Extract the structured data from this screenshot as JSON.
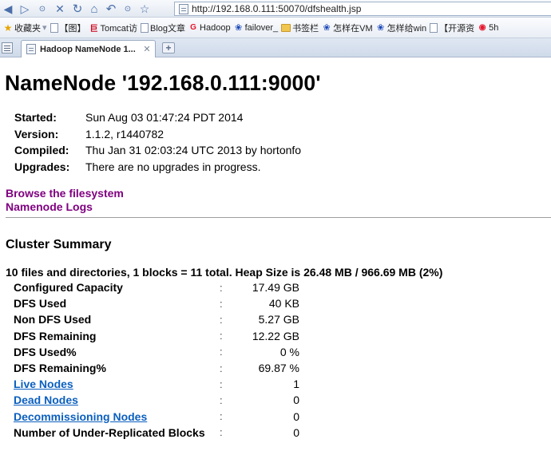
{
  "browser": {
    "url": "http://192.168.0.111:50070/dfshealth.jsp",
    "nav_icons": [
      "back-icon",
      "forward-icon",
      "dropdown-icon",
      "stop-icon",
      "refresh-icon",
      "home-icon",
      "history-icon",
      "dropdown-icon",
      "favorite-star-icon"
    ],
    "bookmarks": [
      {
        "label": "收藏夹",
        "icon": "star-icon"
      },
      {
        "label": "【图】",
        "icon": "page-icon"
      },
      {
        "label": "Tomcat访",
        "icon": "ju-icon"
      },
      {
        "label": "Blog文章",
        "icon": "page-icon"
      },
      {
        "label": "Hadoop",
        "icon": "weibo-icon"
      },
      {
        "label": "failover_",
        "icon": "paw-icon"
      },
      {
        "label": "书签栏",
        "icon": "folder-icon"
      },
      {
        "label": "怎样在VM",
        "icon": "paw-icon"
      },
      {
        "label": "怎样给win",
        "icon": "paw-icon"
      },
      {
        "label": "【开源资",
        "icon": "page-icon"
      },
      {
        "label": "5h",
        "icon": "weibo-icon"
      }
    ],
    "tab_title": "Hadoop NameNode 1..."
  },
  "page": {
    "title": "NameNode '192.168.0.111:9000'",
    "info": [
      {
        "label": "Started:",
        "value": "Sun Aug 03 01:47:24 PDT 2014"
      },
      {
        "label": "Version:",
        "value": "1.1.2, r1440782"
      },
      {
        "label": "Compiled:",
        "value": "Thu Jan 31 02:03:24 UTC 2013 by hortonfo"
      },
      {
        "label": "Upgrades:",
        "value": "There are no upgrades in progress."
      }
    ],
    "links": [
      {
        "label": "Browse the filesystem"
      },
      {
        "label": "Namenode Logs"
      }
    ],
    "cluster_title": "Cluster Summary",
    "summary_line": "10 files and directories, 1 blocks = 11 total. Heap Size is 26.48 MB / 966.69 MB (2%)",
    "separator": ":",
    "summary": [
      {
        "label": "Configured Capacity",
        "value": "17.49 GB",
        "link": false
      },
      {
        "label": "DFS Used",
        "value": "40 KB",
        "link": false
      },
      {
        "label": "Non DFS Used",
        "value": "5.27 GB",
        "link": false
      },
      {
        "label": "DFS Remaining",
        "value": "12.22 GB",
        "link": false
      },
      {
        "label": "DFS Used%",
        "value": "0 %",
        "link": false
      },
      {
        "label": "DFS Remaining%",
        "value": "69.87 %",
        "link": false
      },
      {
        "label": "Live Nodes",
        "value": "1",
        "link": true
      },
      {
        "label": "Dead Nodes",
        "value": "0",
        "link": true
      },
      {
        "label": "Decommissioning Nodes",
        "value": "0",
        "link": true
      },
      {
        "label": "Number of Under-Replicated Blocks",
        "value": "0",
        "link": false
      }
    ]
  }
}
